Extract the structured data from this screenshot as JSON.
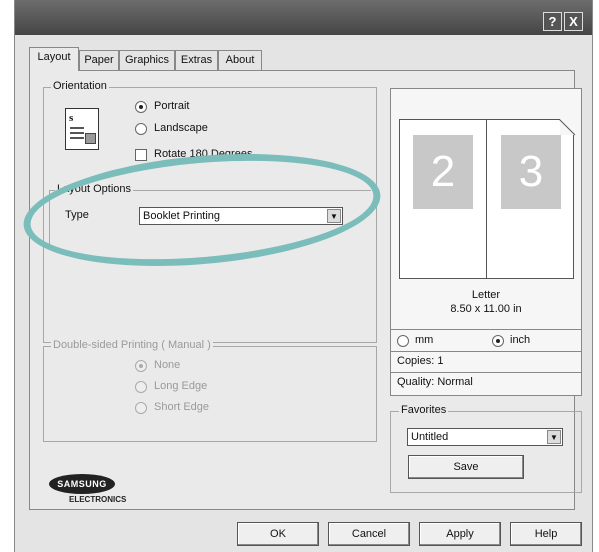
{
  "titlebar": {
    "help_label": "?",
    "close_label": "X"
  },
  "tabs": [
    {
      "label": "Layout"
    },
    {
      "label": "Paper"
    },
    {
      "label": "Graphics"
    },
    {
      "label": "Extras"
    },
    {
      "label": "About"
    }
  ],
  "orientation": {
    "title": "Orientation",
    "portrait": "Portrait",
    "landscape": "Landscape",
    "rotate": "Rotate 180 Degrees",
    "selected": "Portrait"
  },
  "layout_options": {
    "title": "Layout Options",
    "type_label": "Type",
    "type_value": "Booklet Printing"
  },
  "duplex": {
    "title": "Double-sided Printing ( Manual )",
    "none": "None",
    "long_edge": "Long Edge",
    "short_edge": "Short Edge",
    "selected": "None"
  },
  "preview": {
    "page_left": "2",
    "page_right": "3",
    "paper_name": "Letter",
    "paper_size": "8.50 x 11.00 in",
    "unit_mm": "mm",
    "unit_inch": "inch",
    "unit_selected": "inch",
    "copies": "Copies: 1",
    "quality": "Quality: Normal"
  },
  "favorites": {
    "title": "Favorites",
    "value": "Untitled",
    "save_label": "Save"
  },
  "logo": {
    "brand": "SAMSUNG",
    "sub": "ELECTRONICS"
  },
  "buttons": {
    "ok": "OK",
    "cancel": "Cancel",
    "apply": "Apply",
    "help": "Help"
  },
  "colors": {
    "highlight_oval": "#7bbdbb",
    "titlebar": "#555555"
  }
}
